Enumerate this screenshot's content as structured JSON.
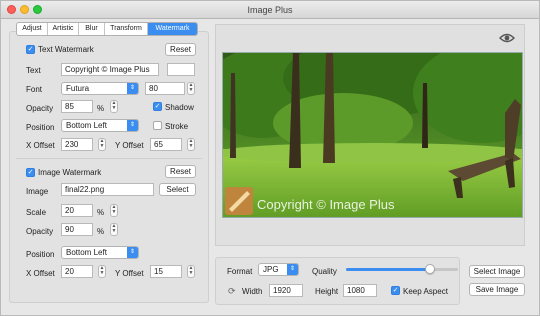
{
  "window": {
    "title": "Image Plus"
  },
  "tabs": [
    "Adjust",
    "Artistic",
    "Blur",
    "Transform",
    "Watermark"
  ],
  "active_tab": "Watermark",
  "text_watermark": {
    "title": "Text Watermark",
    "enabled": true,
    "reset_label": "Reset",
    "text_label": "Text",
    "text_value": "Copyright © Image Plus",
    "font_label": "Font",
    "font_value": "Futura",
    "font_size": "80",
    "opacity_label": "Opacity",
    "opacity_value": "85",
    "percent": "%",
    "shadow_label": "Shadow",
    "shadow_checked": true,
    "position_label": "Position",
    "position_value": "Bottom Left",
    "stroke_label": "Stroke",
    "stroke_checked": false,
    "x_offset_label": "X Offset",
    "x_offset_value": "230",
    "y_offset_label": "Y Offset",
    "y_offset_value": "65"
  },
  "image_watermark": {
    "title": "Image Watermark",
    "enabled": true,
    "reset_label": "Reset",
    "image_label": "Image",
    "image_value": "final22.png",
    "select_label": "Select",
    "scale_label": "Scale",
    "scale_value": "20",
    "percent": "%",
    "opacity_label": "Opacity",
    "opacity_value": "90",
    "position_label": "Position",
    "position_value": "Bottom Left",
    "x_offset_label": "X Offset",
    "x_offset_value": "20",
    "y_offset_label": "Y Offset",
    "y_offset_value": "15"
  },
  "preview": {
    "watermark_text": "Copyright © Image Plus"
  },
  "export": {
    "format_label": "Format",
    "format_value": "JPG",
    "quality_label": "Quality",
    "quality_fraction": 0.75,
    "width_label": "Width",
    "width_value": "1920",
    "height_label": "Height",
    "height_value": "1080",
    "keep_aspect_label": "Keep Aspect",
    "keep_aspect_checked": true,
    "select_image_label": "Select Image",
    "save_image_label": "Save Image"
  },
  "colors": {
    "accent": "#3b8ef0",
    "grass": "#7fbf3a"
  }
}
